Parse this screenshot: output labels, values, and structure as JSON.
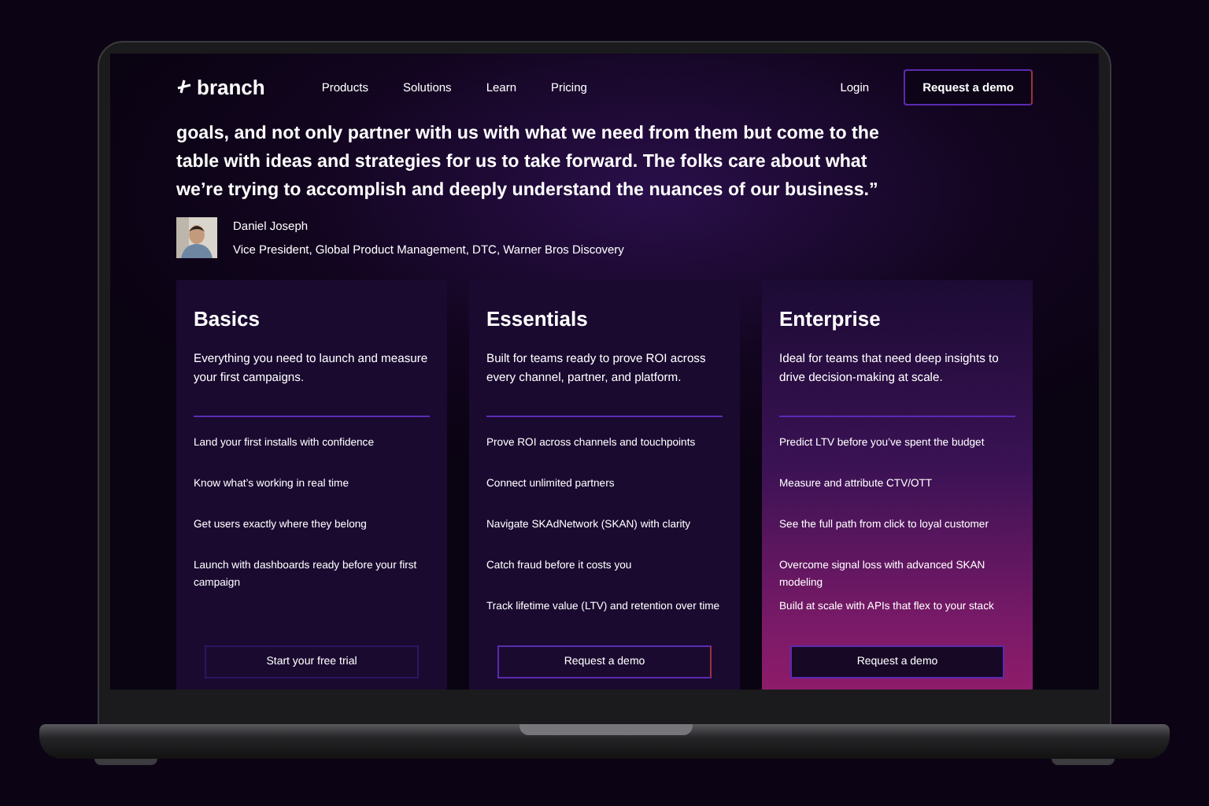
{
  "nav": {
    "logo": "branch",
    "links": [
      "Products",
      "Solutions",
      "Learn",
      "Pricing"
    ],
    "login": "Login",
    "cta": "Request a demo"
  },
  "quote": {
    "lines": [
      "goals, and not only partner with us with what we need from them but come to the",
      "table with ideas and strategies for us to take forward. The folks care about what",
      "we’re trying to accomplish and deeply understand the nuances of our business.”"
    ],
    "author": "Daniel Joseph",
    "role": "Vice President, Global Product Management, DTC, Warner Bros Discovery"
  },
  "plans": [
    {
      "name": "Basics",
      "featured": false,
      "description": "Everything you need to launch and measure your first campaigns.",
      "features": [
        "Land your first installs with confidence",
        "Know what’s working in real time",
        "Get users exactly where they belong",
        "Launch with dashboards ready before your first campaign"
      ],
      "button": {
        "label": "Start your free trial",
        "kind": "outline"
      }
    },
    {
      "name": "Essentials",
      "featured": false,
      "description": "Built for teams ready to prove ROI across every channel, partner, and platform.",
      "features": [
        "Prove ROI across channels and touchpoints",
        "Connect unlimited partners",
        "Navigate SKAdNetwork (SKAN) with clarity",
        "Catch fraud before it costs you",
        "Track lifetime value (LTV) and retention over time"
      ],
      "button": {
        "label": "Request a demo",
        "kind": "gradient"
      }
    },
    {
      "name": "Enterprise",
      "featured": true,
      "description": "Ideal for teams that need deep insights to drive decision-making at scale.",
      "features": [
        "Predict LTV before you’ve spent the budget",
        "Measure and attribute CTV/OTT",
        "See the full path from click to loyal customer",
        "Overcome signal loss with advanced SKAN modeling",
        "Build at scale with APIs that flex to your stack"
      ],
      "button": {
        "label": "Request a demo",
        "kind": "filled"
      }
    }
  ]
}
